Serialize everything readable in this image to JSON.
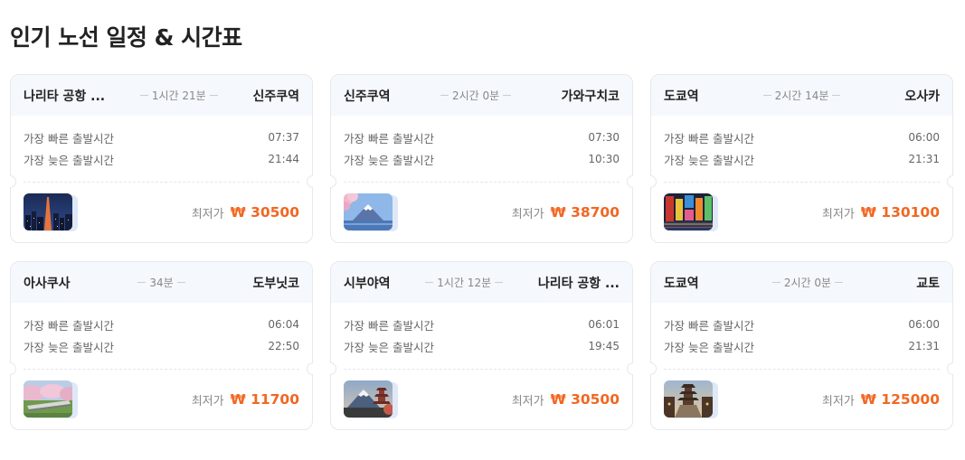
{
  "page": {
    "title": "인기 노선 일정 & 시간표"
  },
  "labels": {
    "earliest": "가장 빠른 출발시간",
    "latest": "가장 늦은 출발시간",
    "lowest_price": "최저가"
  },
  "routes": [
    {
      "from": "나리타 공항 ...",
      "duration": "1시간 21분",
      "to": "신주쿠역",
      "earliest": "07:37",
      "latest": "21:44",
      "price": "₩ 30500",
      "image": "tokyo-night-skyline"
    },
    {
      "from": "신주쿠역",
      "duration": "2시간 0분",
      "to": "가와구치코",
      "earliest": "07:30",
      "latest": "10:30",
      "price": "₩ 38700",
      "image": "mount-fuji-cherry-blossom"
    },
    {
      "from": "도쿄역",
      "duration": "2시간 14분",
      "to": "오사카",
      "earliest": "06:00",
      "latest": "21:31",
      "price": "₩ 130100",
      "image": "osaka-dotonbori-night"
    },
    {
      "from": "아사쿠사",
      "duration": "34분",
      "to": "도부닛코",
      "earliest": "06:04",
      "latest": "22:50",
      "price": "₩ 11700",
      "image": "train-cherry-blossom"
    },
    {
      "from": "시부야역",
      "duration": "1시간 12분",
      "to": "나리타 공항 ...",
      "earliest": "06:01",
      "latest": "19:45",
      "price": "₩ 30500",
      "image": "mount-fuji-pagoda"
    },
    {
      "from": "도쿄역",
      "duration": "2시간 0분",
      "to": "교토",
      "earliest": "06:00",
      "latest": "21:31",
      "price": "₩ 125000",
      "image": "kyoto-yasaka-pagoda"
    }
  ],
  "colors": {
    "price": "#f26722",
    "header_bg": "#f5f8fc",
    "border": "#e6e8ec"
  }
}
